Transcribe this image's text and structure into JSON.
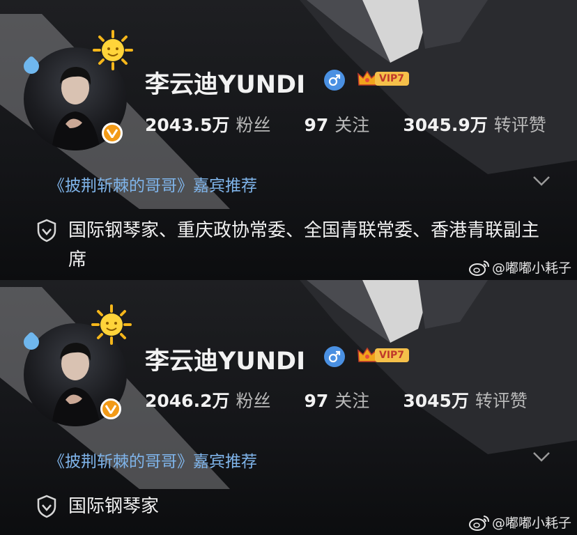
{
  "colors": {
    "background": "#141518",
    "guest_link": "#7fb4ea",
    "verified_badge": "#f29a17",
    "vip_tag": "#f5c04a",
    "male_badge": "#4a90e2"
  },
  "panels": [
    {
      "profile_name": "李云迪YUNDI",
      "vip_label": "VIP7",
      "stats": [
        {
          "value": "2043.5万",
          "label": "粉丝"
        },
        {
          "value": "97",
          "label": "关注"
        },
        {
          "value": "3045.9万",
          "label": "转评赞"
        }
      ],
      "guest_recommendation": "《披荆斩棘的哥哥》嘉宾推荐",
      "bio": "国际钢琴家、重庆政协常委、全国青联常委、香港青联副主席",
      "watermark": "@嘟嘟小耗子",
      "icons": [
        "sun-icon",
        "male-icon",
        "vip-crown-icon",
        "verified-icon",
        "shield-icon",
        "chevron-down-icon",
        "weibo-logo-icon"
      ]
    },
    {
      "profile_name": "李云迪YUNDI",
      "vip_label": "VIP7",
      "stats": [
        {
          "value": "2046.2万",
          "label": "粉丝"
        },
        {
          "value": "97",
          "label": "关注"
        },
        {
          "value": "3045万",
          "label": "转评赞"
        }
      ],
      "guest_recommendation": "《披荆斩棘的哥哥》嘉宾推荐",
      "bio": "国际钢琴家",
      "watermark": "@嘟嘟小耗子",
      "icons": [
        "sun-icon",
        "male-icon",
        "vip-crown-icon",
        "verified-icon",
        "shield-icon",
        "chevron-down-icon",
        "weibo-logo-icon"
      ]
    }
  ]
}
